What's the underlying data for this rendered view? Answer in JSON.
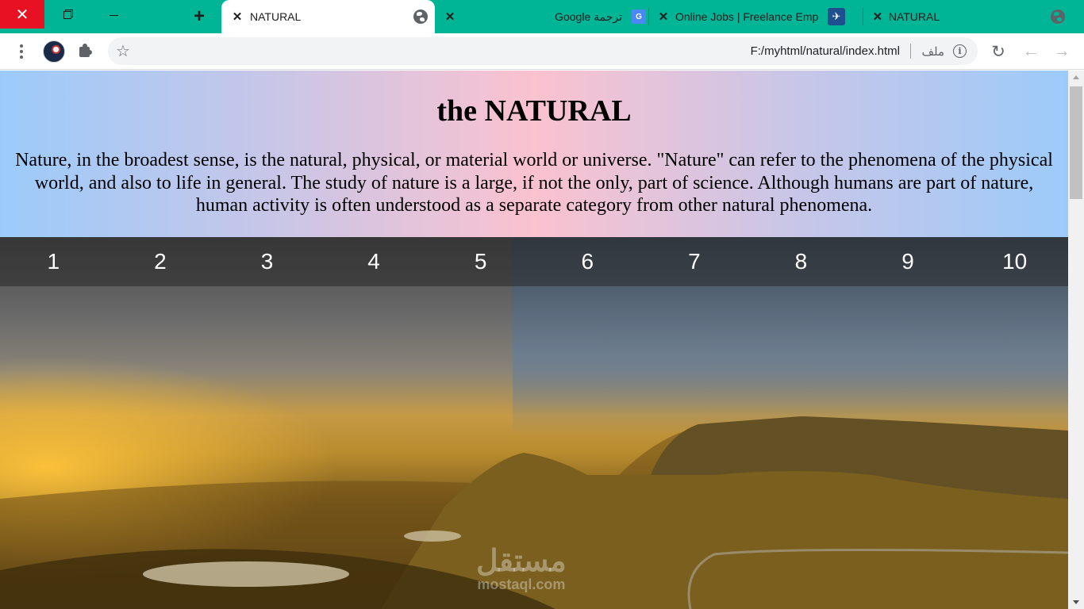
{
  "tabs": [
    {
      "title": "NATURAL",
      "active": true
    },
    {
      "title": "ترجمة Google",
      "active": false
    },
    {
      "title": "Online Jobs | Freelance Emp",
      "active": false
    },
    {
      "title": "NATURAL",
      "active": false
    }
  ],
  "window": {
    "close_glyph": "✕",
    "new_tab_glyph": "+"
  },
  "omnibox": {
    "url": "F:/myhtml/natural/index.html",
    "scheme_label": "ملف"
  },
  "page": {
    "title": "the NATURAL",
    "paragraph": "Nature, in the broadest sense, is the natural, physical, or material world or universe. \"Nature\" can refer to the phenomena of the physical world, and also to life in general. The study of nature is a large, if not the only, part of science. Although humans are part of nature, human activity is often understood as a separate category from other natural phenomena.",
    "nav": [
      "1",
      "2",
      "3",
      "4",
      "5",
      "6",
      "7",
      "8",
      "9",
      "10"
    ],
    "watermark": {
      "logo": "مستقل",
      "domain": "mostaql.com"
    }
  },
  "colors": {
    "tab_strip": "#00b496",
    "close_button": "#e81123",
    "hero_blue": "#9ccbfa",
    "hero_pink": "#fbc2cf"
  }
}
